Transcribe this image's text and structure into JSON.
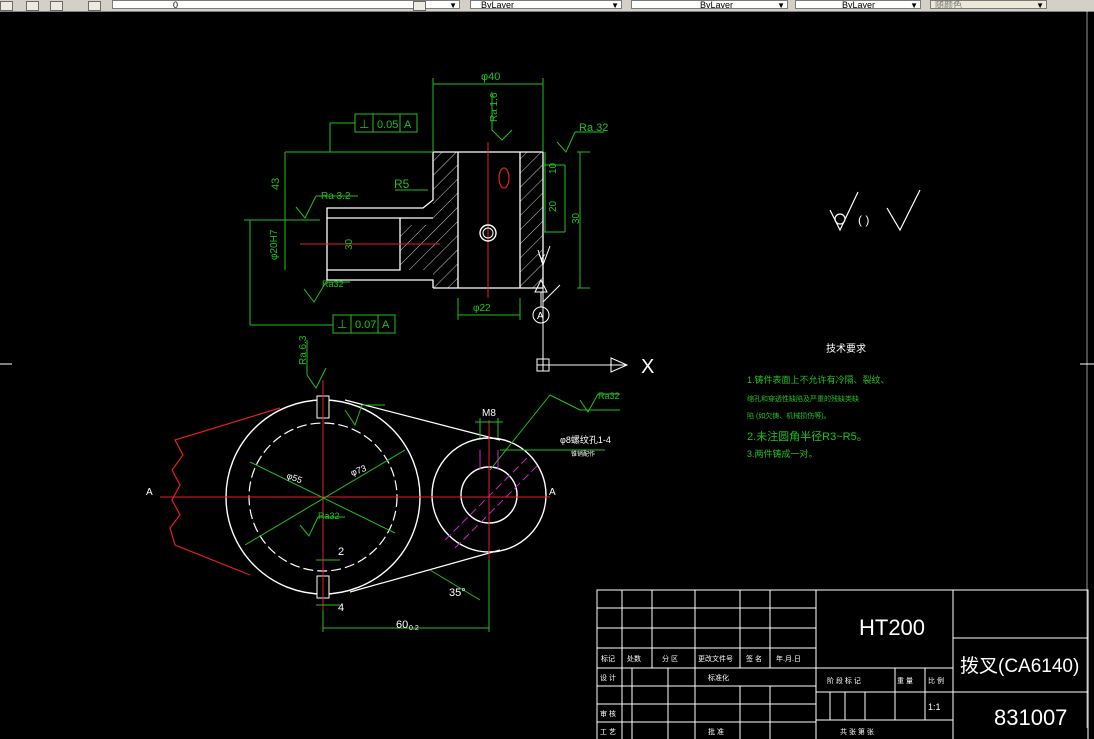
{
  "toolbar": {
    "layer_value": "0",
    "color_value": "ByLayer",
    "linetype_value": "ByLayer",
    "lineweight_value": "ByLayer",
    "plotstyle_value": "随颜色",
    "dropdown_arrow": "▼"
  },
  "drawing": {
    "dim_phi40": "φ40",
    "dim_ra16": "Ra 1.6",
    "dim_ra32_a": "Ra 32",
    "dim_ra32_b": "Ra 3.2",
    "dim_ra32_c": "Ra32",
    "dim_ra32_d": "Ra32",
    "dim_ra32_e": "Ra32",
    "dim_ra63": "Ra 6.3",
    "tol_perp1_value": "0.05",
    "tol_perp1_datum": "A",
    "tol_perp2_value": "0.07",
    "tol_perp2_datum": "A",
    "perp_symbol": "⊥",
    "dim_r5": "R5",
    "dim_43": "43",
    "dim_10": "10",
    "dim_20": "20",
    "dim_30_right": "30",
    "dim_30_inner": "30",
    "dim_phi20": "φ20H7",
    "dim_phi22": "φ22",
    "dim_phi8": "φ8",
    "dim_phi55": "φ55",
    "dim_phi73": "φ73",
    "dim_m8": "M8",
    "dim_m8_thread": "φ8螺纹孔1-4",
    "dim_m8_sub": "锥销配作",
    "dim_2": "2",
    "dim_4": "4",
    "dim_60": "60",
    "dim_60_tol": "0.2",
    "dim_35deg": "35°",
    "section_a_left": "A",
    "section_a_right": "A",
    "datum_a": "A",
    "axis_x": "X",
    "axis_y": "Y",
    "rough_symbols": "(  )"
  },
  "notes": {
    "title": "技术要求",
    "line1": "1.铸件表面上不允许有冷隔、裂纹、",
    "line2": "缩孔和穿透性缺陷及严重的残缺类缺",
    "line3": "陷 (如欠铸、机械损伤等)。",
    "line4": "2.未注圆角半径R3~R5。",
    "line5": "3.两件铸成一对。"
  },
  "titleblock": {
    "material": "HT200",
    "part_name": "拨叉(CA6140)",
    "drawing_no": "831007",
    "scale": "1:1",
    "h_mark": "标记",
    "h_count": "处数",
    "h_zone": "分 区",
    "h_change": "更改文件号",
    "h_sign": "签 名",
    "h_date": "年.月.日",
    "h_design": "设 计",
    "h_standard": "标准化",
    "h_check": "审 核",
    "h_process": "工 艺",
    "h_approve": "批 准",
    "h_stage": "阶 段 标 记",
    "h_weight": "重 量",
    "h_ratio": "比 例",
    "h_sheets": "共  张   第  张"
  }
}
